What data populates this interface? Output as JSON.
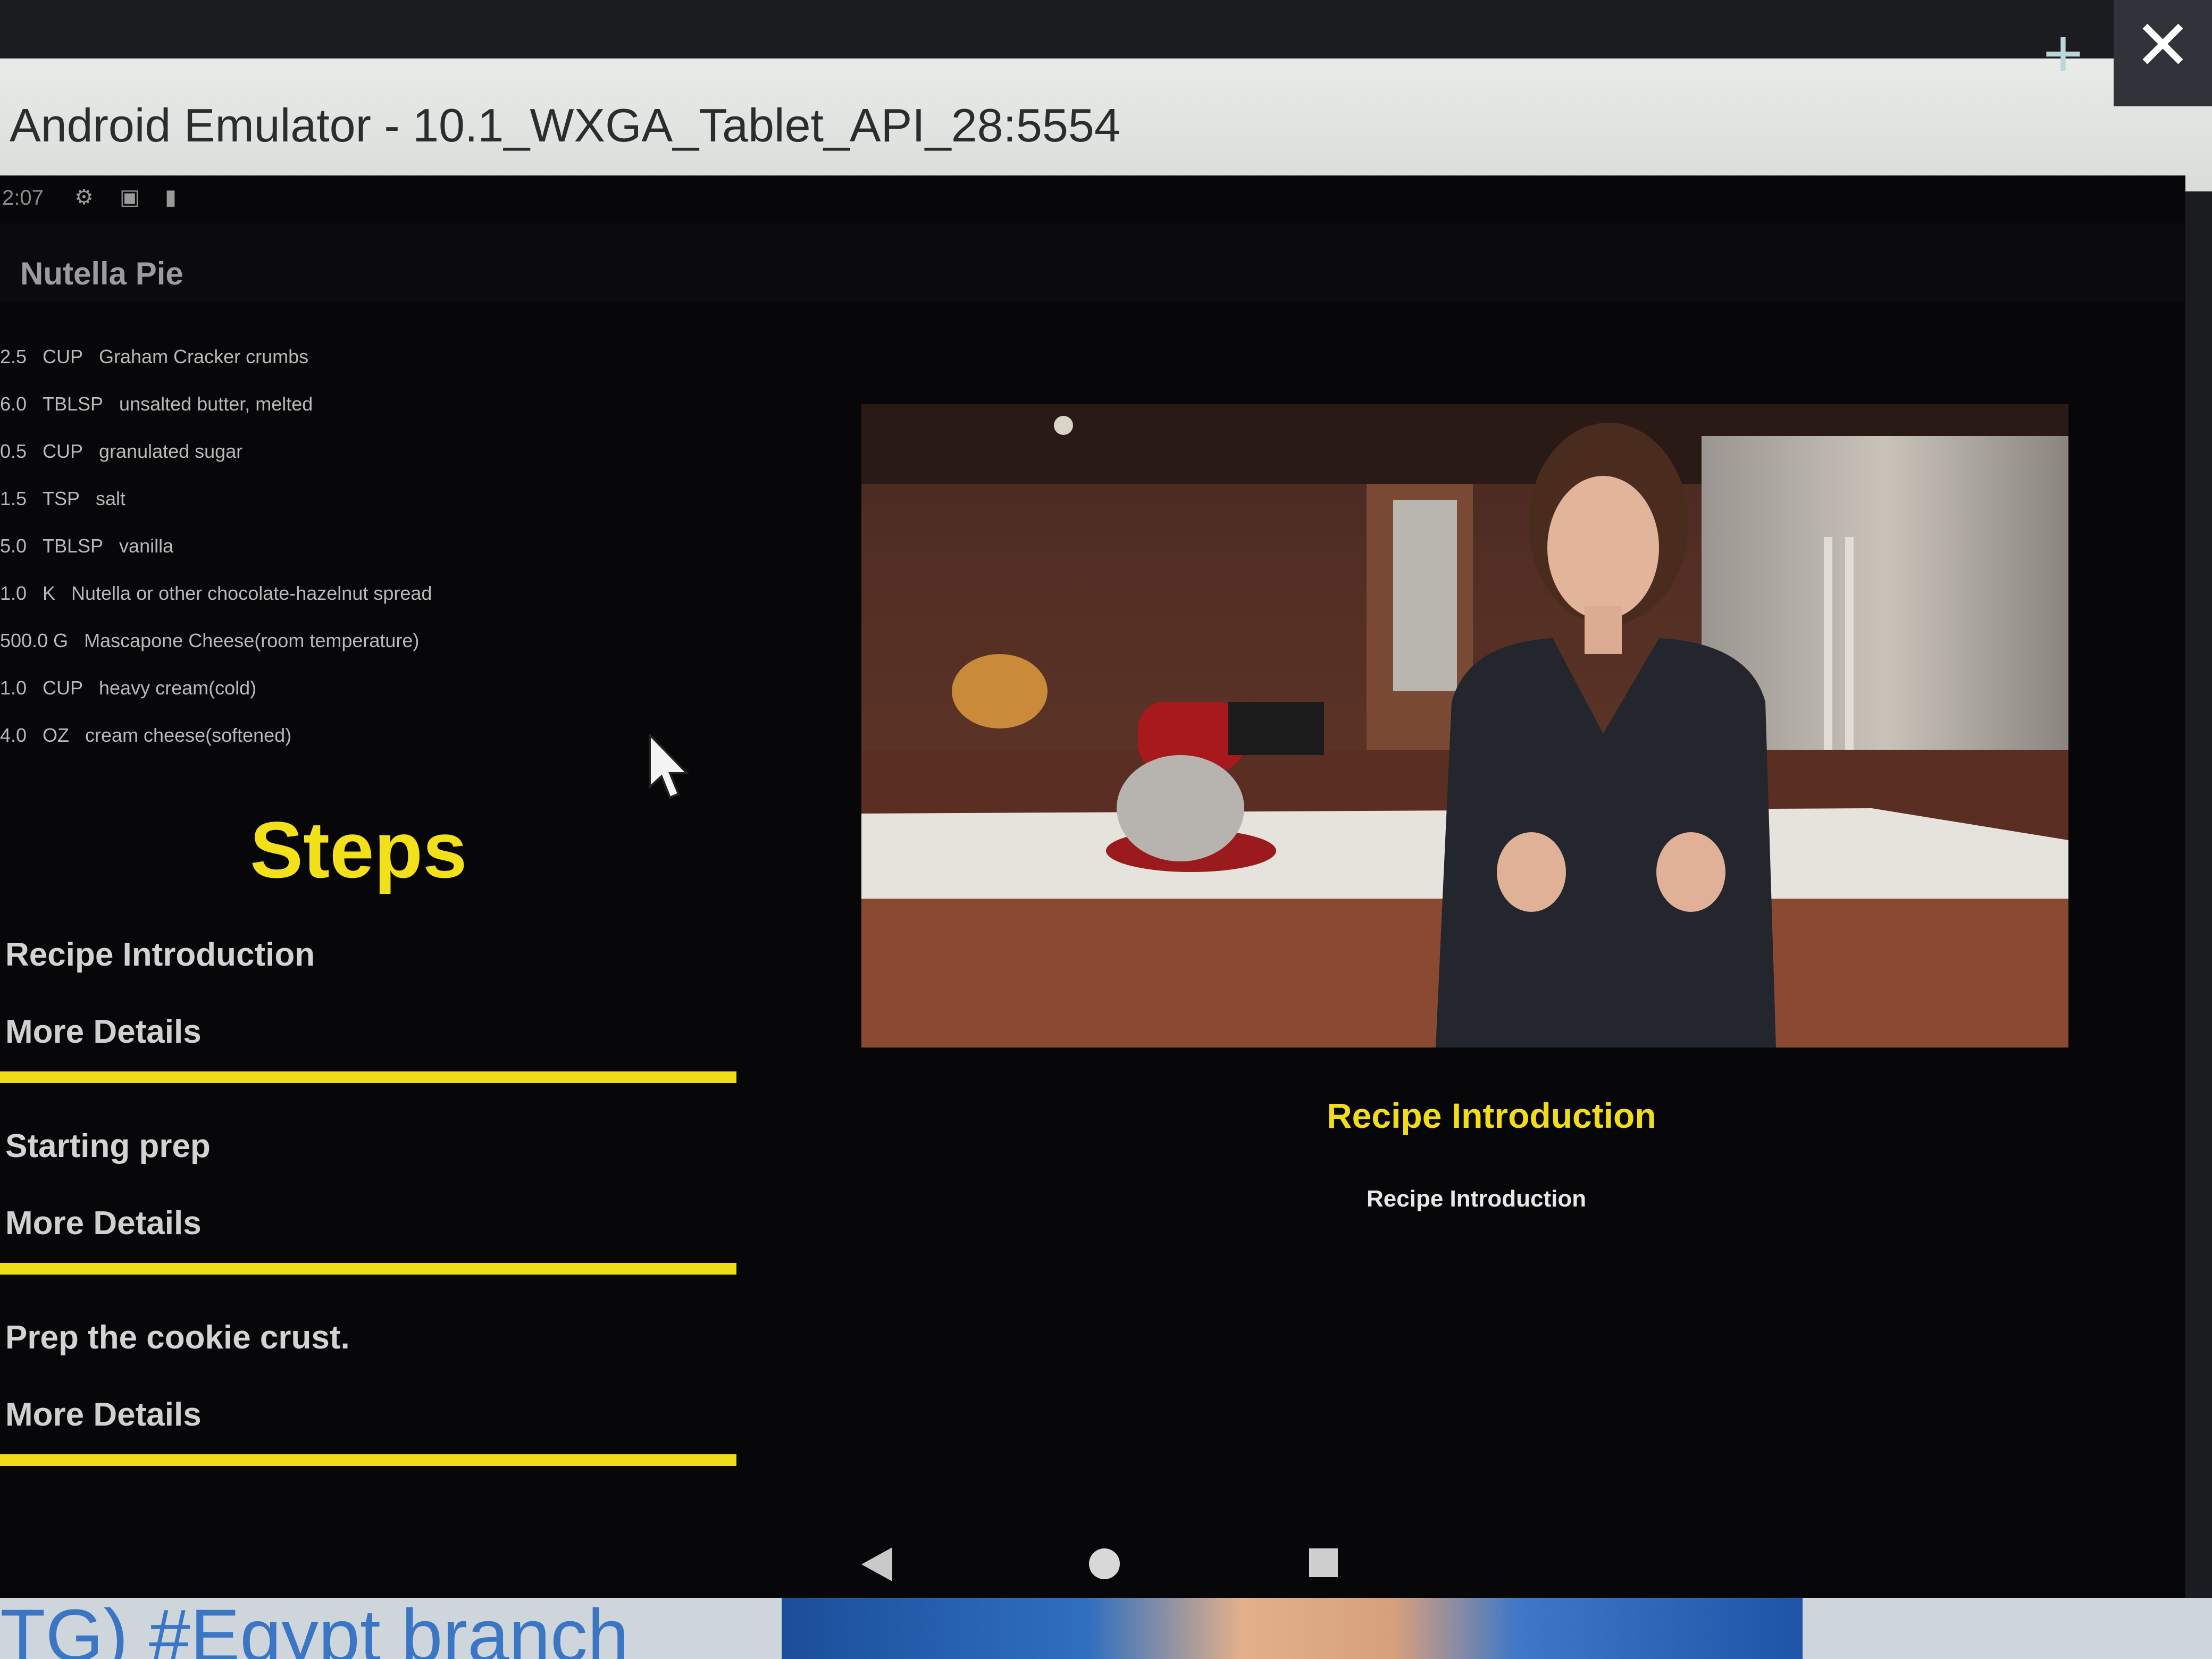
{
  "window": {
    "title": "Android Emulator - 10.1_WXGA_Tablet_API_28:5554",
    "add_label": "+",
    "close_label": "✕"
  },
  "status_bar": {
    "time": "2:07"
  },
  "app": {
    "title": "Nutella Pie"
  },
  "ingredients": [
    {
      "quantity": "2.5",
      "unit": "CUP",
      "name": "Graham Cracker crumbs"
    },
    {
      "quantity": "6.0",
      "unit": "TBLSP",
      "name": "unsalted butter, melted"
    },
    {
      "quantity": "0.5",
      "unit": "CUP",
      "name": "granulated sugar"
    },
    {
      "quantity": "1.5",
      "unit": "TSP",
      "name": "salt"
    },
    {
      "quantity": "5.0",
      "unit": "TBLSP",
      "name": "vanilla"
    },
    {
      "quantity": "1.0",
      "unit": "K",
      "name": "Nutella or other chocolate-hazelnut spread"
    },
    {
      "quantity": "500.0",
      "unit": "G",
      "name": "Mascapone Cheese(room temperature)"
    },
    {
      "quantity": "1.0",
      "unit": "CUP",
      "name": "heavy cream(cold)"
    },
    {
      "quantity": "4.0",
      "unit": "OZ",
      "name": "cream cheese(softened)"
    }
  ],
  "steps_heading": "Steps",
  "steps": [
    {
      "title": "Recipe Introduction",
      "more": "More Details"
    },
    {
      "title": "Starting prep",
      "more": "More Details"
    },
    {
      "title": "Prep the cookie crust.",
      "more": "More Details"
    }
  ],
  "detail": {
    "step_title": "Recipe Introduction",
    "description": "Recipe Introduction"
  },
  "background": {
    "banner_text": "TG) #Egypt branch"
  },
  "colors": {
    "accent_yellow": "#f0dc16",
    "screen_bg": "#070709",
    "titlebar_bg": "#e0e2df"
  },
  "icons": [
    "gear-icon",
    "sd-card-icon",
    "battery-small-icon",
    "wifi-icon",
    "battery-icon",
    "cursor-icon",
    "back-icon",
    "home-icon",
    "recents-icon"
  ]
}
